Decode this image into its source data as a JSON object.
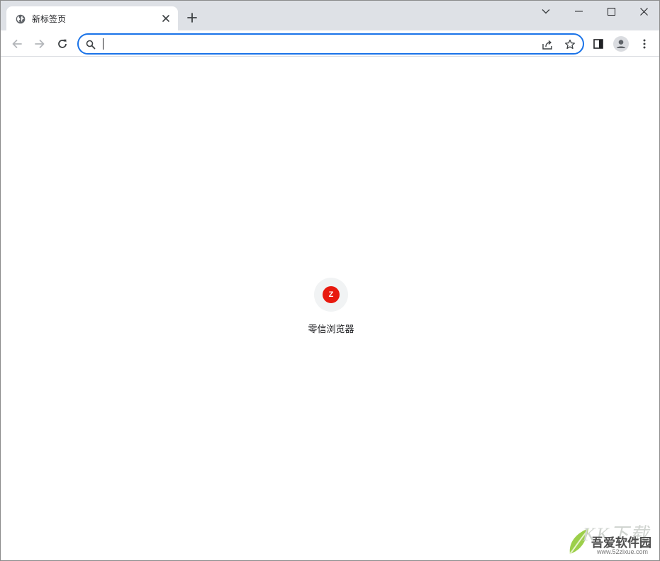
{
  "tab": {
    "title": "新标签页",
    "favicon": "globe-icon",
    "close_icon": "close-icon"
  },
  "tabstrip": {
    "new_tab_icon": "plus-icon"
  },
  "window_controls": {
    "tab_search_icon": "chevron-down-icon",
    "minimize_icon": "minimize-icon",
    "maximize_icon": "maximize-icon",
    "close_icon": "close-icon"
  },
  "toolbar": {
    "back_icon": "arrow-left-icon",
    "forward_icon": "arrow-right-icon",
    "reload_icon": "reload-icon",
    "side_panel_icon": "side-panel-icon",
    "profile_icon": "profile-icon",
    "menu_icon": "more-vert-icon"
  },
  "omnibox": {
    "value": "",
    "placeholder": "",
    "search_icon": "search-icon",
    "share_icon": "share-icon",
    "bookmark_icon": "star-icon",
    "focus_color": "#1a73e8"
  },
  "shortcuts": [
    {
      "label": "零信浏览器",
      "favicon_letter": "Z",
      "favicon_color": "#e8190e"
    }
  ],
  "watermark": {
    "top": "KK下载",
    "brand": "吾爱软件园",
    "url": "www.52zixue.com"
  },
  "colors": {
    "tabstrip_bg": "#dee1e6",
    "accent": "#1a73e8"
  }
}
